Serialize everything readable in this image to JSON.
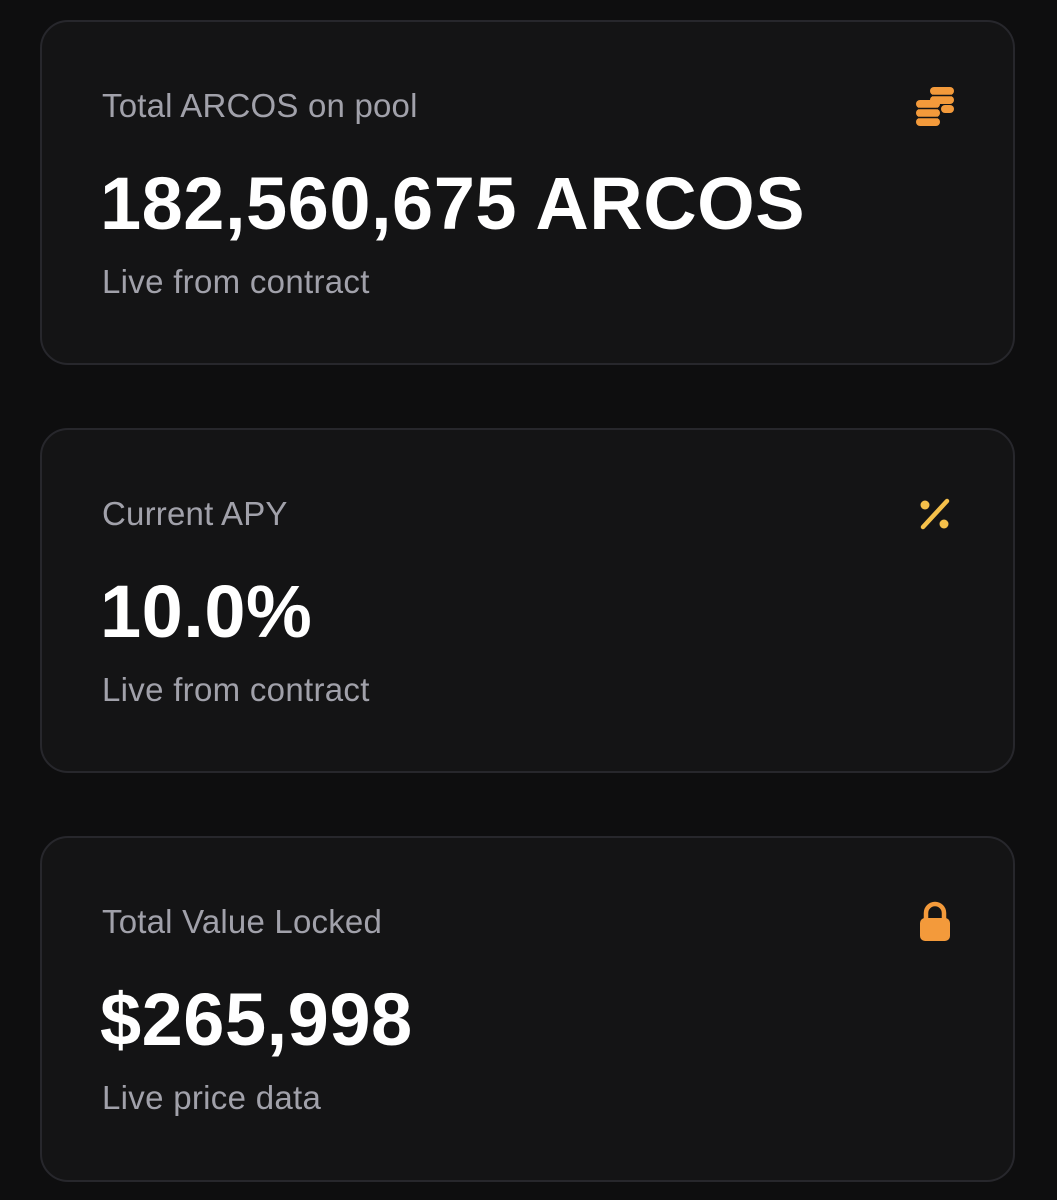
{
  "colors": {
    "background": "#0e0e0f",
    "card": "#141415",
    "card_border": "#27272c",
    "label": "#a1a1aa",
    "value": "#ffffff",
    "icon_orange": "#f39a3b",
    "icon_yellow": "#f5c04a"
  },
  "cards": [
    {
      "label": "Total ARCOS on pool",
      "value": "182,560,675 ARCOS",
      "sub": "Live from contract",
      "icon": "coins-icon"
    },
    {
      "label": "Current APY",
      "value": "10.0%",
      "sub": "Live from contract",
      "icon": "percent-icon"
    },
    {
      "label": "Total Value Locked",
      "value": "$265,998",
      "sub": "Live price data",
      "icon": "lock-icon"
    }
  ]
}
